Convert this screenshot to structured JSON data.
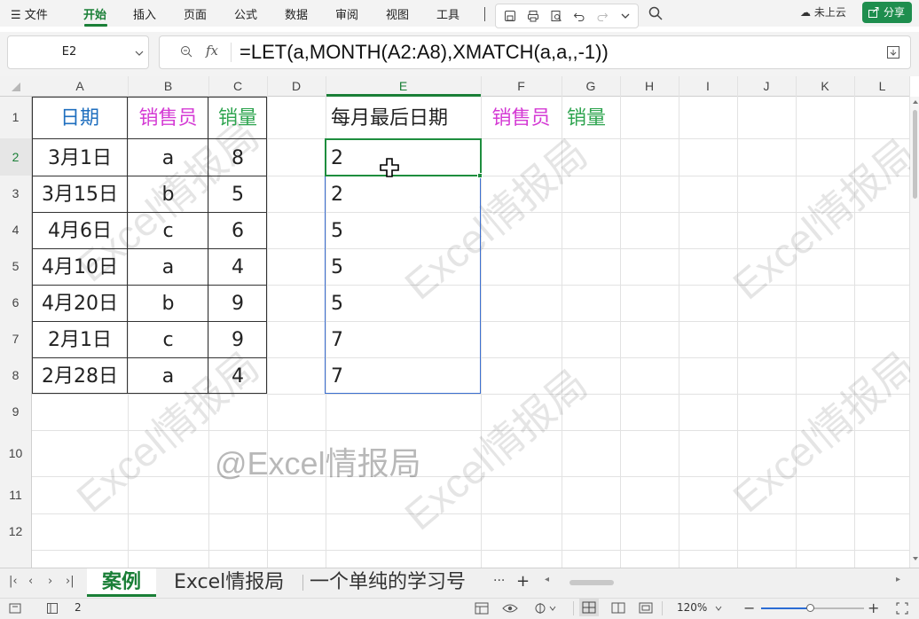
{
  "menu": {
    "file_label": "文件",
    "tabs": [
      "开始",
      "插入",
      "页面",
      "公式",
      "数据",
      "审阅",
      "视图",
      "工具"
    ],
    "cloud_label": "未上云",
    "share_label": "分享"
  },
  "formula_bar": {
    "name_box": "E2",
    "fx_label": "fx",
    "formula": "=LET(a,MONTH(A2:A8),XMATCH(a,a,,-1))"
  },
  "columns": [
    "A",
    "B",
    "C",
    "D",
    "E",
    "F",
    "G",
    "H",
    "I",
    "J",
    "K",
    "L"
  ],
  "rows": [
    "1",
    "2",
    "3",
    "4",
    "5",
    "6",
    "7",
    "8",
    "9",
    "10",
    "11",
    "12"
  ],
  "headers": {
    "date": "日期",
    "seller": "销售员",
    "qty": "销量",
    "last_date": "每月最后日期",
    "seller2": "销售员",
    "qty2": "销量"
  },
  "table": [
    {
      "date": "3月1日",
      "seller": "a",
      "qty": "8",
      "result": "2"
    },
    {
      "date": "3月15日",
      "seller": "b",
      "qty": "5",
      "result": "2"
    },
    {
      "date": "4月6日",
      "seller": "c",
      "qty": "6",
      "result": "5"
    },
    {
      "date": "4月10日",
      "seller": "a",
      "qty": "4",
      "result": "5"
    },
    {
      "date": "4月20日",
      "seller": "b",
      "qty": "9",
      "result": "5"
    },
    {
      "date": "2月1日",
      "seller": "c",
      "qty": "9",
      "result": "7"
    },
    {
      "date": "2月28日",
      "seller": "a",
      "qty": "4",
      "result": "7"
    }
  ],
  "watermark": "@Excel情报局",
  "watermark_tile": "Excel情报局",
  "sheet_tabs": [
    "案例",
    "Excel情报局",
    "一个单纯的学习号"
  ],
  "sheet_more": "···",
  "sheet_add": "+",
  "status": {
    "count": "2",
    "zoom": "120%"
  },
  "colors": {
    "date_header": "#1f6fbf",
    "seller_header": "#d43ad4",
    "qty_header": "#2ea44f",
    "accent": "#1a7f37"
  }
}
